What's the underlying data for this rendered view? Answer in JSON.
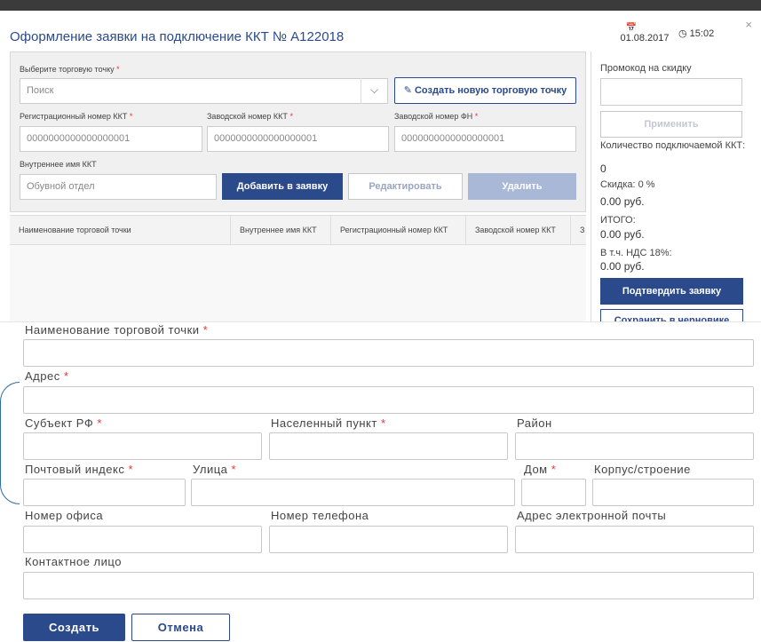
{
  "dialog": {
    "title": "Оформление заявки на подключение ККТ № A122018",
    "date": "01.08.2017",
    "time": "15:02",
    "close": "×"
  },
  "outlet_select": {
    "label": "Выберите торговую точку",
    "placeholder": "Поиск",
    "create_button": "Создать новую торговую точку"
  },
  "kkt_fields": {
    "reg_label": "Регистрационный номер ККТ",
    "reg_value": "0000000000000000001",
    "serial_label": "Заводской номер ККТ",
    "serial_value": "0000000000000000001",
    "fn_label": "Заводской номер ФН",
    "fn_value": "0000000000000000001",
    "internal_label": "Внутреннее имя ККТ",
    "internal_value": "Обувной отдел"
  },
  "actions": {
    "add": "Добавить в заявку",
    "edit": "Редактировать",
    "delete": "Удалить"
  },
  "table": {
    "columns": [
      "Наименование торговой точки",
      "Внутреннее имя ККТ",
      "Регистрационный номер ККТ",
      "Заводской номер ККТ",
      "З"
    ]
  },
  "side": {
    "promo_label": "Промокод на скидку",
    "apply": "Применить",
    "count_label": "Количество подключаемой ККТ:",
    "count_value": "0",
    "discount_label": "Скидка:",
    "discount_pct": "0 %",
    "discount_value": "0.00 руб.",
    "total_label": "ИТОГО:",
    "total_value": "0.00 руб.",
    "vat_label": "В т.ч. НДС 18%:",
    "vat_value": "0.00 руб.",
    "confirm": "Подтвердить заявку",
    "save_draft": "Сохранить в черновике"
  },
  "form": {
    "outlet_name": "Наименование торговой точки",
    "address": "Адрес",
    "region": "Субъект РФ",
    "locality": "Населенный пункт",
    "district": "Район",
    "postcode": "Почтовый индекс",
    "street": "Улица",
    "house": "Дом",
    "building": "Корпус/строение",
    "office": "Номер офиса",
    "phone": "Номер телефона",
    "email": "Адрес электронной почты",
    "contact": "Контактное лицо",
    "required_mark": "*",
    "create": "Создать",
    "cancel": "Отмена"
  },
  "colors": {
    "primary": "#2b4a8b",
    "required": "#e33333"
  },
  "icons": {
    "calendar": "calendar-icon",
    "clock": "clock-icon",
    "pencil": "pencil-icon",
    "chevron": "chevron-down-icon"
  }
}
